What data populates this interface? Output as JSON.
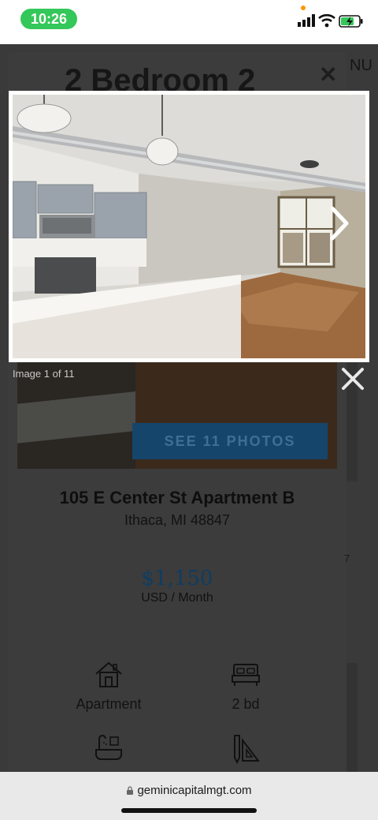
{
  "status_bar": {
    "time": "10:26"
  },
  "background_page": {
    "title": "2 Bedroom 2",
    "menu_fragment": "NU",
    "close_glyph": "✕",
    "see_photos_label": "SEE 11 PHOTOS",
    "address": "105 E Center St Apartment B",
    "city": "Ithaca, MI 48847",
    "price": "$1,150",
    "price_unit": "USD / Month",
    "features": [
      {
        "label": "Apartment",
        "icon": "house-icon"
      },
      {
        "label": "2 bd",
        "icon": "bed-icon"
      },
      {
        "label": "",
        "icon": "bath-icon"
      },
      {
        "label": "",
        "icon": "ruler-pencil-icon"
      }
    ],
    "side_digit": "7"
  },
  "lightbox": {
    "caption": "Image 1 of 11",
    "next_icon": "chevron-right-icon",
    "close_icon": "close-icon"
  },
  "browser": {
    "url": "geminicapitalmgt.com"
  },
  "colors": {
    "accent_blue": "#16456b",
    "status_green": "#34c759",
    "price_blue": "#0e3d64"
  }
}
